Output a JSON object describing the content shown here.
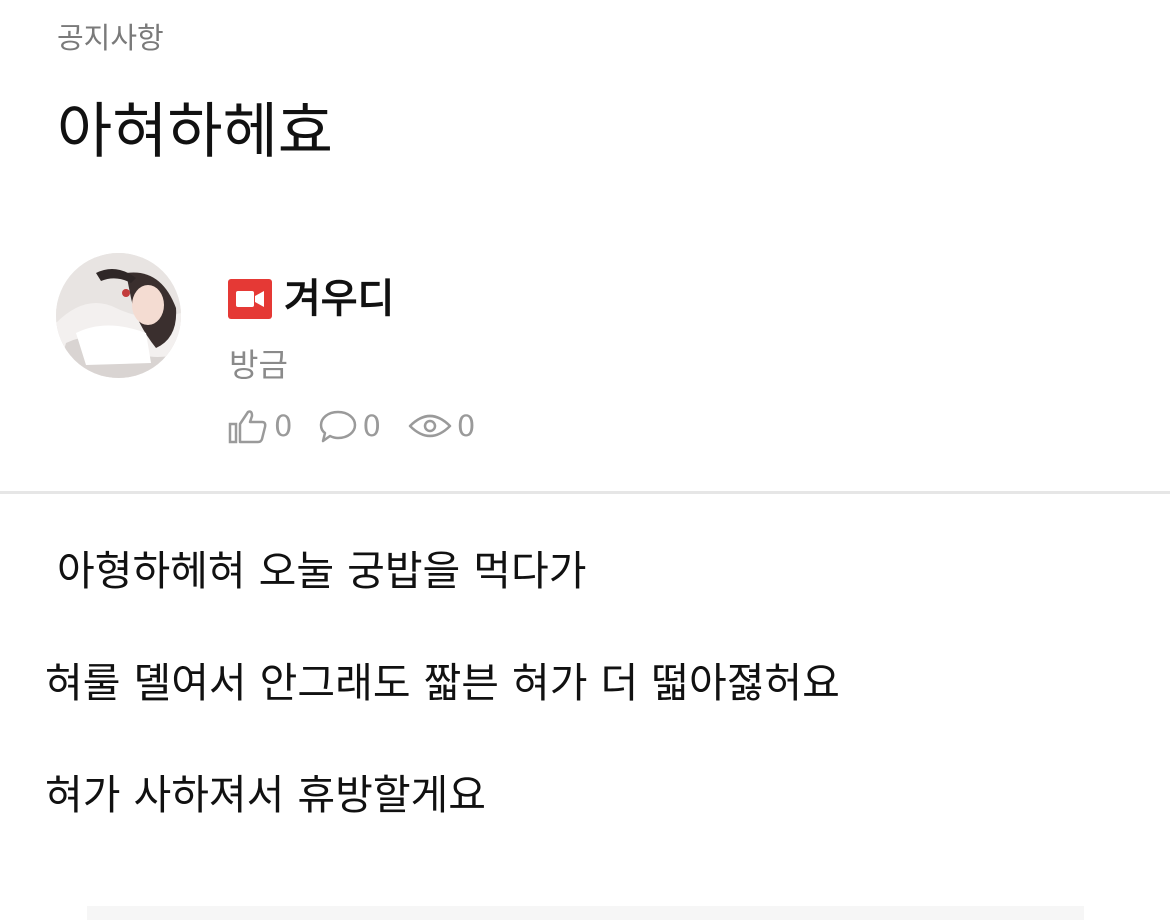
{
  "post": {
    "category": "공지사항",
    "title": "아혀하헤효",
    "author": {
      "name": "겨우디",
      "badge_icon": "live-camera-icon",
      "badge_color": "#e53935"
    },
    "time": "방금",
    "stats": {
      "likes": "0",
      "comments": "0",
      "views": "0"
    },
    "body": [
      "아형하헤혀 오눌 궁밥을 먹다가",
      "혀룰 뎰여서 안그래도 짧븐 혀가 더 떫아졇허요",
      "혀가 사하져서 휴방할게요"
    ]
  }
}
